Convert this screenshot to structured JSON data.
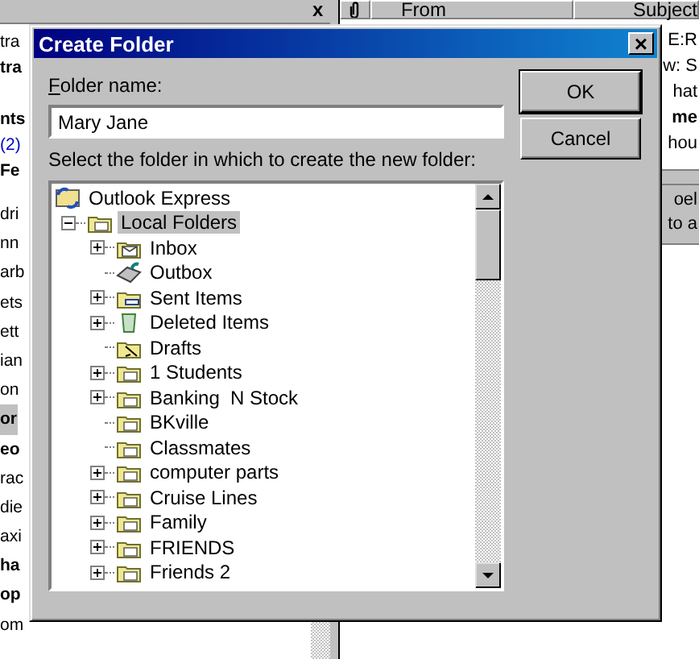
{
  "background_window": {
    "pane_close": "x",
    "columns": [
      {
        "kind": "attachment"
      },
      {
        "kind": "text",
        "label": "From"
      },
      {
        "kind": "text",
        "label": "Subject"
      }
    ],
    "folder_rows": [
      {
        "text": "tra",
        "bold": false,
        "kind": "folder"
      },
      {
        "text": "tra",
        "bold": true,
        "kind": "folder"
      },
      {
        "text": "nts",
        "bold": true,
        "kind": "folder"
      },
      {
        "text": "(2)",
        "bold": false,
        "kind": "count"
      },
      {
        "text": "Fe",
        "bold": true,
        "kind": "folder"
      }
    ],
    "contact_rows": [
      {
        "text": "dri",
        "bold": false,
        "selected": false
      },
      {
        "text": "nn",
        "bold": false,
        "selected": false
      },
      {
        "text": "arb",
        "bold": false,
        "selected": false
      },
      {
        "text": "ets",
        "bold": false,
        "selected": false
      },
      {
        "text": "ett",
        "bold": false,
        "selected": false
      },
      {
        "text": "ian",
        "bold": false,
        "selected": false
      },
      {
        "text": "on",
        "bold": false,
        "selected": false
      },
      {
        "text": "or",
        "bold": true,
        "selected": true
      },
      {
        "text": "eo",
        "bold": true,
        "selected": false
      },
      {
        "text": "rac",
        "bold": false,
        "selected": false
      },
      {
        "text": "die",
        "bold": false,
        "selected": false
      },
      {
        "text": "axi",
        "bold": false,
        "selected": false
      },
      {
        "text": "ha",
        "bold": true,
        "selected": false
      },
      {
        "text": "op",
        "bold": true,
        "selected": false
      },
      {
        "text": "om",
        "bold": false,
        "selected": false
      }
    ],
    "message_rows": [
      {
        "text": "E:R",
        "bold": false
      },
      {
        "text": "w: S",
        "bold": false
      },
      {
        "text": "hat",
        "bold": false
      },
      {
        "text": "me",
        "bold": true
      },
      {
        "text": "hou",
        "bold": false
      }
    ],
    "preview_lines": [
      "oel",
      "to a"
    ]
  },
  "dialog": {
    "title": "Create Folder",
    "close": "×",
    "name_label": "Folder name:",
    "name_value": "Mary Jane",
    "ok": "OK",
    "cancel": "Cancel",
    "tree_label": "Select the folder in which to create the new folder:",
    "tree": [
      {
        "label": "Outlook Express",
        "kind": "root",
        "selected": false,
        "children": [
          {
            "label": "Local Folders",
            "kind": "folders",
            "has_children": true,
            "expanded": true,
            "selected": true,
            "children": [
              {
                "label": "Inbox",
                "kind": "inbox",
                "has_children": true,
                "expanded": false,
                "selected": false
              },
              {
                "label": "Outbox",
                "kind": "outbox",
                "has_children": false,
                "selected": false
              },
              {
                "label": "Sent Items",
                "kind": "sent",
                "has_children": true,
                "expanded": false,
                "selected": false
              },
              {
                "label": "Deleted Items",
                "kind": "deleted",
                "has_children": true,
                "expanded": false,
                "selected": false
              },
              {
                "label": "Drafts",
                "kind": "drafts",
                "has_children": false,
                "selected": false
              },
              {
                "label": "1 Students",
                "kind": "folder",
                "has_children": true,
                "expanded": false,
                "selected": false
              },
              {
                "label": "Banking  N Stock",
                "kind": "folder",
                "has_children": true,
                "expanded": false,
                "selected": false
              },
              {
                "label": "BKville",
                "kind": "folder",
                "has_children": false,
                "selected": false
              },
              {
                "label": "Classmates",
                "kind": "folder",
                "has_children": false,
                "selected": false
              },
              {
                "label": "computer parts",
                "kind": "folder",
                "has_children": true,
                "expanded": false,
                "selected": false
              },
              {
                "label": "Cruise Lines",
                "kind": "folder",
                "has_children": true,
                "expanded": false,
                "selected": false
              },
              {
                "label": "Family",
                "kind": "folder",
                "has_children": true,
                "expanded": false,
                "selected": false
              },
              {
                "label": "FRIENDS",
                "kind": "folder",
                "has_children": true,
                "expanded": false,
                "selected": false
              },
              {
                "label": "Friends 2",
                "kind": "folder",
                "has_children": true,
                "expanded": false,
                "selected": false
              }
            ]
          }
        ]
      }
    ]
  }
}
